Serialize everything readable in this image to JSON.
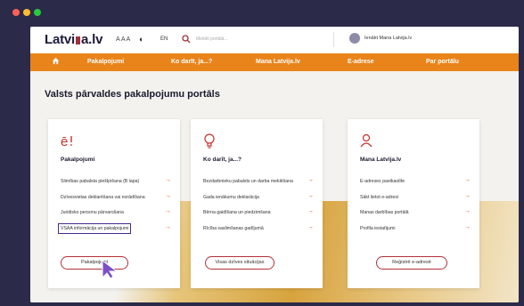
{
  "window": {
    "dots": [
      {
        "name": "close",
        "color": "#ff5f57"
      },
      {
        "name": "minimize",
        "color": "#febc2e"
      },
      {
        "name": "maximize",
        "color": "#28c840"
      }
    ]
  },
  "header": {
    "logo": {
      "part1": "Latvi",
      "part2": "a.lv"
    },
    "font_size_label": "A A A",
    "lang": "EN",
    "search_placeholder": "Meklēt portālā...",
    "login_label": "Ienākt Mana Latvija.lv"
  },
  "nav": {
    "items": [
      "Pakalpojumi",
      "Ko darīt, ja...?",
      "Mana Latvija.lv",
      "E-adrese",
      "Par portālu"
    ]
  },
  "page_title": "Valsts pārvaldes pakalpojumu portāls",
  "cards": [
    {
      "icon": "e-service-icon",
      "title": "Pakalpojumi",
      "items": [
        "Slimības pabalsta piešķiršana (B lapa)",
        "Dzīvesvietas deklarēšana vai norādīšana",
        "Juridisko personu pārvarošana",
        "VSAA informācija un pakalpojumi"
      ],
      "button": "Pakalpojumi"
    },
    {
      "icon": "lightbulb-icon",
      "title": "Ko darīt, ja...?",
      "items": [
        "Bezdarbnieku pabalsts un darba meklēšana",
        "Gada ienākumu deklarācija",
        "Bērna gaidīšana un piedzimšana",
        "Rīcība saslimšanas gadījumā"
      ],
      "button": "Visas dzīves situācijas"
    },
    {
      "icon": "user-icon",
      "title": "Mana Latvija.lv",
      "items": [
        "E-adreses pastkastīte",
        "Sākt lietot e-adresi",
        "Manas darbības portālā",
        "Profila iestatījumi"
      ],
      "button": "Reģistrē e-adresē"
    }
  ],
  "colors": {
    "accent": "#e9841a",
    "arrow": "#e0482c",
    "button_border": "#b5303a"
  }
}
